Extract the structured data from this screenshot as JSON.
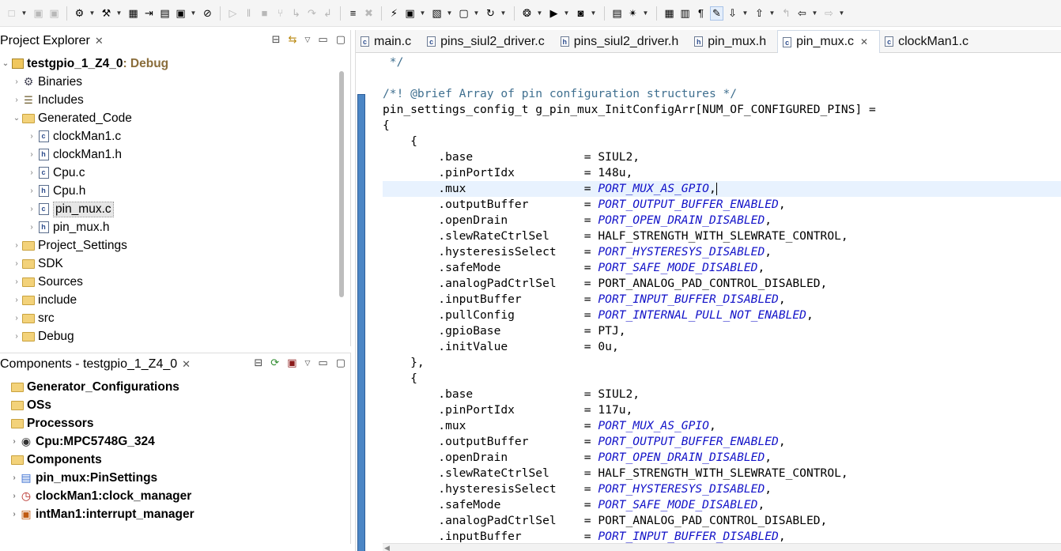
{
  "toolbar": {
    "items": [
      {
        "icon": "new-file-icon",
        "glyph": "□",
        "dim": true,
        "dropdown": true
      },
      {
        "icon": "save-icon",
        "glyph": "▣",
        "dim": true,
        "dropdown": false
      },
      {
        "icon": "save-all-icon",
        "glyph": "▣",
        "dim": true,
        "dropdown": false
      },
      {
        "sep": true
      },
      {
        "icon": "settings-icon",
        "glyph": "⚙",
        "dim": false,
        "dropdown": true
      },
      {
        "icon": "build-icon",
        "glyph": "⚒",
        "dim": false,
        "dropdown": true
      },
      {
        "icon": "binary-icon",
        "glyph": "▦",
        "dim": false,
        "dropdown": false
      },
      {
        "icon": "generate-code-icon",
        "glyph": "⇥",
        "dim": false,
        "dropdown": false
      },
      {
        "icon": "components-icon",
        "glyph": "▤",
        "dim": false,
        "dropdown": false
      },
      {
        "icon": "terminal-icon",
        "glyph": "▣",
        "dim": false,
        "dropdown": true
      },
      {
        "icon": "skip-breakpoints-icon",
        "glyph": "⊘",
        "dim": false,
        "dropdown": false
      },
      {
        "sep": true
      },
      {
        "icon": "resume-icon",
        "glyph": "▷",
        "dim": true,
        "dropdown": false
      },
      {
        "icon": "suspend-icon",
        "glyph": "‖",
        "dim": true,
        "dropdown": false
      },
      {
        "icon": "terminate-icon",
        "glyph": "■",
        "dim": true,
        "dropdown": false
      },
      {
        "icon": "disconnect-icon",
        "glyph": "⑂",
        "dim": true,
        "dropdown": false
      },
      {
        "icon": "step-into-icon",
        "glyph": "↳",
        "dim": true,
        "dropdown": false
      },
      {
        "icon": "step-over-icon",
        "glyph": "↷",
        "dim": true,
        "dropdown": false
      },
      {
        "icon": "step-return-icon",
        "glyph": "↲",
        "dim": true,
        "dropdown": false
      },
      {
        "sep": true
      },
      {
        "icon": "instruction-step-icon",
        "glyph": "≡",
        "dim": false,
        "dropdown": false
      },
      {
        "icon": "reset-icon",
        "glyph": "✖",
        "dim": true,
        "dropdown": false
      },
      {
        "sep": true
      },
      {
        "icon": "flash-icon",
        "glyph": "⚡",
        "dim": false,
        "dropdown": false
      },
      {
        "icon": "new-project-icon",
        "glyph": "▣",
        "dim": false,
        "dropdown": true
      },
      {
        "icon": "open-type-icon",
        "glyph": "▧",
        "dim": false,
        "dropdown": true
      },
      {
        "icon": "new-class-icon",
        "glyph": "▢",
        "dim": false,
        "dropdown": true
      },
      {
        "icon": "refresh-icon",
        "glyph": "↻",
        "dim": false,
        "dropdown": true
      },
      {
        "sep": true
      },
      {
        "icon": "debug-icon",
        "glyph": "❂",
        "dim": false,
        "dropdown": true
      },
      {
        "icon": "run-icon",
        "glyph": "▶",
        "dim": false,
        "dropdown": true
      },
      {
        "icon": "external-tools-icon",
        "glyph": "◙",
        "dim": false,
        "dropdown": true
      },
      {
        "sep": true
      },
      {
        "icon": "open-folder-icon",
        "glyph": "▤",
        "dim": false,
        "dropdown": false
      },
      {
        "icon": "search-icon",
        "glyph": "✴",
        "dim": false,
        "dropdown": true
      },
      {
        "sep": true
      },
      {
        "icon": "toggle-breadcrumb-icon",
        "glyph": "▦",
        "dim": false,
        "dropdown": false
      },
      {
        "icon": "toggle-mark-icon",
        "glyph": "▥",
        "dim": false,
        "dropdown": false
      },
      {
        "icon": "show-whitespace-icon",
        "glyph": "¶",
        "dim": false,
        "dropdown": false
      },
      {
        "icon": "highlight-icon",
        "glyph": "✎",
        "dim": false,
        "dropdown": false,
        "highlight": true
      },
      {
        "icon": "next-annotation-icon",
        "glyph": "⇩",
        "dim": false,
        "dropdown": true
      },
      {
        "icon": "prev-annotation-icon",
        "glyph": "⇧",
        "dim": false,
        "dropdown": true
      },
      {
        "icon": "last-edit-icon",
        "glyph": "↰",
        "dim": true,
        "dropdown": false
      },
      {
        "icon": "back-icon",
        "glyph": "⇦",
        "dim": false,
        "dropdown": true
      },
      {
        "icon": "forward-icon",
        "glyph": "⇨",
        "dim": true,
        "dropdown": true
      }
    ]
  },
  "explorer": {
    "title": "Project Explorer",
    "tree": [
      {
        "label": "testgpio_1_Z4_0",
        "suffix": ": Debug",
        "icon": "project-folder-icon",
        "iconClass": "ic-proj",
        "indent": 0,
        "twisty": "⌄",
        "bold": true
      },
      {
        "label": "Binaries",
        "icon": "binaries-icon",
        "iconClass": "ic-bin",
        "indent": 1,
        "twisty": "›"
      },
      {
        "label": "Includes",
        "icon": "includes-icon",
        "iconClass": "ic-inc",
        "indent": 1,
        "twisty": "›"
      },
      {
        "label": "Generated_Code",
        "icon": "folder-icon",
        "iconClass": "ic-folder",
        "indent": 1,
        "twisty": "⌄"
      },
      {
        "label": "clockMan1.c",
        "icon": "c-file-icon",
        "iconClass": "ic-c",
        "indent": 2,
        "twisty": "›"
      },
      {
        "label": "clockMan1.h",
        "icon": "h-file-icon",
        "iconClass": "ic-h",
        "indent": 2,
        "twisty": "›"
      },
      {
        "label": "Cpu.c",
        "icon": "c-file-icon",
        "iconClass": "ic-c",
        "indent": 2,
        "twisty": "›"
      },
      {
        "label": "Cpu.h",
        "icon": "h-file-icon",
        "iconClass": "ic-h",
        "indent": 2,
        "twisty": "›"
      },
      {
        "label": "pin_mux.c",
        "icon": "c-file-icon",
        "iconClass": "ic-c",
        "indent": 2,
        "twisty": "›",
        "selected": true
      },
      {
        "label": "pin_mux.h",
        "icon": "h-file-icon",
        "iconClass": "ic-h",
        "indent": 2,
        "twisty": "›"
      },
      {
        "label": "Project_Settings",
        "icon": "folder-icon",
        "iconClass": "ic-folder",
        "indent": 1,
        "twisty": "›"
      },
      {
        "label": "SDK",
        "icon": "folder-icon",
        "iconClass": "ic-folder",
        "indent": 1,
        "twisty": "›"
      },
      {
        "label": "Sources",
        "icon": "folder-icon",
        "iconClass": "ic-folder",
        "indent": 1,
        "twisty": "›"
      },
      {
        "label": "include",
        "icon": "folder-icon",
        "iconClass": "ic-folder",
        "indent": 1,
        "twisty": "›"
      },
      {
        "label": "src",
        "icon": "folder-icon",
        "iconClass": "ic-folder",
        "indent": 1,
        "twisty": "›"
      },
      {
        "label": "Debug",
        "icon": "folder-icon",
        "iconClass": "ic-folder",
        "indent": 1,
        "twisty": "›"
      }
    ]
  },
  "components": {
    "title": "Components - testgpio_1_Z4_0",
    "tree": [
      {
        "label": "Generator_Configurations",
        "icon": "folder-icon",
        "iconClass": "ic-folder",
        "indent": 0,
        "twisty": "",
        "bold": true
      },
      {
        "label": "OSs",
        "icon": "folder-icon",
        "iconClass": "ic-folder",
        "indent": 0,
        "twisty": "",
        "bold": true
      },
      {
        "label": "Processors",
        "icon": "folder-icon",
        "iconClass": "ic-folder",
        "indent": 0,
        "twisty": "",
        "bold": true
      },
      {
        "label": "Cpu:MPC5748G_324",
        "icon": "cpu-icon",
        "iconClass": "ic-cpu",
        "indent": 1,
        "twisty": "›",
        "bold": true
      },
      {
        "label": "Components",
        "icon": "folder-icon",
        "iconClass": "ic-folder",
        "indent": 0,
        "twisty": "",
        "bold": true
      },
      {
        "label": "pin_mux:PinSettings",
        "icon": "pin-settings-icon",
        "iconClass": "ic-pin",
        "indent": 1,
        "twisty": "›",
        "bold": true
      },
      {
        "label": "clockMan1:clock_manager",
        "icon": "clock-manager-icon",
        "iconClass": "ic-clk",
        "indent": 1,
        "twisty": "›",
        "bold": true
      },
      {
        "label": "intMan1:interrupt_manager",
        "icon": "interrupt-manager-icon",
        "iconClass": "ic-int",
        "indent": 1,
        "twisty": "›",
        "bold": true
      }
    ]
  },
  "editor": {
    "tabs": [
      {
        "label": "main.c",
        "type": "c",
        "active": false,
        "close": false
      },
      {
        "label": "pins_siul2_driver.c",
        "type": "c",
        "active": false,
        "close": false
      },
      {
        "label": "pins_siul2_driver.h",
        "type": "h",
        "active": false,
        "close": false
      },
      {
        "label": "pin_mux.h",
        "type": "h",
        "active": false,
        "close": false
      },
      {
        "label": "pin_mux.c",
        "type": "c",
        "active": true,
        "close": true
      },
      {
        "label": "clockMan1.c",
        "type": "c",
        "active": false,
        "close": false
      }
    ],
    "lines": [
      {
        "parts": [
          {
            "t": " */",
            "k": "cm"
          }
        ]
      },
      {
        "parts": [
          {
            "t": ""
          }
        ]
      },
      {
        "parts": [
          {
            "t": "/*! @brief Array of pin configuration structures */",
            "k": "cm"
          }
        ]
      },
      {
        "parts": [
          {
            "t": "pin_settings_config_t g_pin_mux_InitConfigArr[NUM_OF_CONFIGURED_PINS] ="
          }
        ]
      },
      {
        "parts": [
          {
            "t": "{"
          }
        ]
      },
      {
        "parts": [
          {
            "t": "    {"
          }
        ]
      },
      {
        "parts": [
          {
            "t": "        .base                = SIUL2,"
          }
        ]
      },
      {
        "parts": [
          {
            "t": "        .pinPortIdx          = 148u,"
          }
        ]
      },
      {
        "parts": [
          {
            "t": "        .mux                 = "
          },
          {
            "t": "PORT_MUX_AS_GPIO",
            "k": "en"
          },
          {
            "t": ","
          }
        ],
        "current": true,
        "caret": true
      },
      {
        "parts": [
          {
            "t": "        .outputBuffer        = "
          },
          {
            "t": "PORT_OUTPUT_BUFFER_ENABLED",
            "k": "en"
          },
          {
            "t": ","
          }
        ]
      },
      {
        "parts": [
          {
            "t": "        .openDrain           = "
          },
          {
            "t": "PORT_OPEN_DRAIN_DISABLED",
            "k": "en"
          },
          {
            "t": ","
          }
        ]
      },
      {
        "parts": [
          {
            "t": "        .slewRateCtrlSel     = HALF_STRENGTH_WITH_SLEWRATE_CONTROL,"
          }
        ]
      },
      {
        "parts": [
          {
            "t": "        .hysteresisSelect    = "
          },
          {
            "t": "PORT_HYSTERESYS_DISABLED",
            "k": "en"
          },
          {
            "t": ","
          }
        ]
      },
      {
        "parts": [
          {
            "t": "        .safeMode            = "
          },
          {
            "t": "PORT_SAFE_MODE_DISABLED",
            "k": "en"
          },
          {
            "t": ","
          }
        ]
      },
      {
        "parts": [
          {
            "t": "        .analogPadCtrlSel    = PORT_ANALOG_PAD_CONTROL_DISABLED,"
          }
        ]
      },
      {
        "parts": [
          {
            "t": "        .inputBuffer         = "
          },
          {
            "t": "PORT_INPUT_BUFFER_DISABLED",
            "k": "en"
          },
          {
            "t": ","
          }
        ]
      },
      {
        "parts": [
          {
            "t": "        .pullConfig          = "
          },
          {
            "t": "PORT_INTERNAL_PULL_NOT_ENABLED",
            "k": "en"
          },
          {
            "t": ","
          }
        ]
      },
      {
        "parts": [
          {
            "t": "        .gpioBase            = PTJ,"
          }
        ]
      },
      {
        "parts": [
          {
            "t": "        .initValue           = 0u,"
          }
        ]
      },
      {
        "parts": [
          {
            "t": "    },"
          }
        ]
      },
      {
        "parts": [
          {
            "t": "    {"
          }
        ]
      },
      {
        "parts": [
          {
            "t": "        .base                = SIUL2,"
          }
        ]
      },
      {
        "parts": [
          {
            "t": "        .pinPortIdx          = 117u,"
          }
        ]
      },
      {
        "parts": [
          {
            "t": "        .mux                 = "
          },
          {
            "t": "PORT_MUX_AS_GPIO",
            "k": "en"
          },
          {
            "t": ","
          }
        ]
      },
      {
        "parts": [
          {
            "t": "        .outputBuffer        = "
          },
          {
            "t": "PORT_OUTPUT_BUFFER_ENABLED",
            "k": "en"
          },
          {
            "t": ","
          }
        ]
      },
      {
        "parts": [
          {
            "t": "        .openDrain           = "
          },
          {
            "t": "PORT_OPEN_DRAIN_DISABLED",
            "k": "en"
          },
          {
            "t": ","
          }
        ]
      },
      {
        "parts": [
          {
            "t": "        .slewRateCtrlSel     = HALF_STRENGTH_WITH_SLEWRATE_CONTROL,"
          }
        ]
      },
      {
        "parts": [
          {
            "t": "        .hysteresisSelect    = "
          },
          {
            "t": "PORT_HYSTERESYS_DISABLED",
            "k": "en"
          },
          {
            "t": ","
          }
        ]
      },
      {
        "parts": [
          {
            "t": "        .safeMode            = "
          },
          {
            "t": "PORT_SAFE_MODE_DISABLED",
            "k": "en"
          },
          {
            "t": ","
          }
        ]
      },
      {
        "parts": [
          {
            "t": "        .analogPadCtrlSel    = PORT_ANALOG_PAD_CONTROL_DISABLED,"
          }
        ]
      },
      {
        "parts": [
          {
            "t": "        .inputBuffer         = "
          },
          {
            "t": "PORT_INPUT_BUFFER_DISABLED",
            "k": "en"
          },
          {
            "t": ","
          }
        ]
      }
    ]
  },
  "colors": {
    "enum": "#1212c8",
    "comment": "#3f6f8f",
    "current_line": "#e8f2fe",
    "debug_label": "#8a6d3b",
    "fold_bar": "#4b86c5"
  }
}
